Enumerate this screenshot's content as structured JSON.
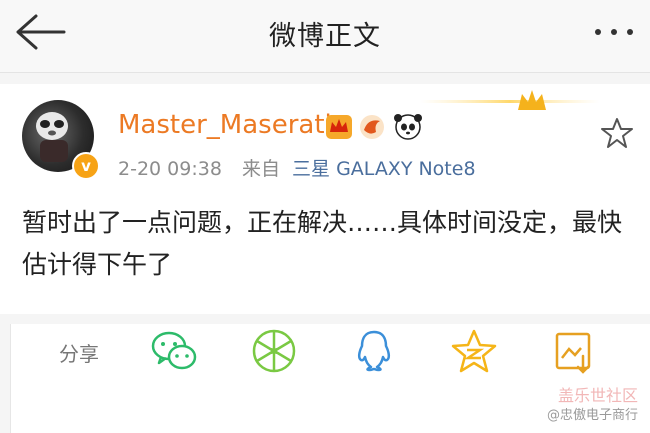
{
  "header": {
    "title": "微博正文",
    "back_icon": "arrow-left-icon",
    "more_icon": "more-dots-icon"
  },
  "post": {
    "username": "Master_Maserati",
    "badges": [
      "vip-crown-icon",
      "phoenix-icon",
      "panda-icon"
    ],
    "time": "2-20 09:38",
    "source_prefix": "来自",
    "source": "三星 GALAXY Note8",
    "text": "暂时出了一点问题，正在解决……具体时间没定，最快估计得下午了"
  },
  "share": {
    "label": "分享",
    "targets": [
      "wechat-icon",
      "wechat-moments-icon",
      "qq-icon",
      "qzone-icon",
      "save-image-icon"
    ]
  },
  "watermark": {
    "title": "盖乐世社区",
    "sub": "@忠傲电子商行"
  },
  "colors": {
    "username": "#ec7a24",
    "source_link": "#4a6e9d",
    "wechat": "#2dbb6a",
    "qq": "#3b8fd9",
    "qzone": "#f5b518",
    "save": "#e6a021"
  }
}
